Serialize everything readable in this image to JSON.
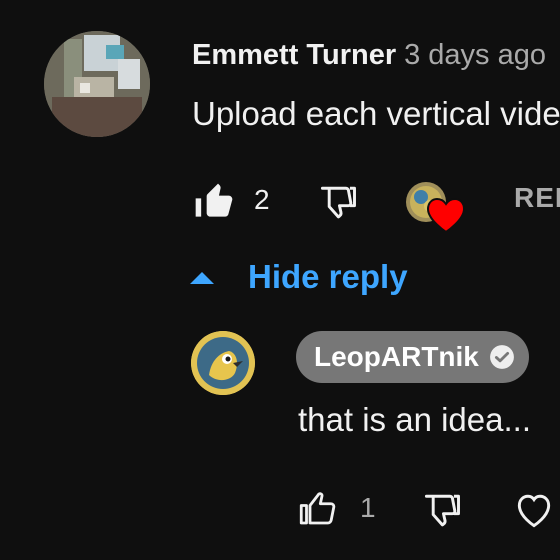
{
  "comment": {
    "author": "Emmett Turner",
    "timestamp": "3 days ago",
    "text": "Upload each vertical video",
    "like_count": "2",
    "reply_label": "REPLY",
    "icons": {
      "like": "thumbs-up-filled-icon",
      "dislike": "thumbs-down-outline-icon",
      "creator_heart": "creator-heart-icon"
    }
  },
  "replies_toggle": {
    "label": "Hide reply",
    "icon": "chevron-up-icon",
    "accent_color": "#3ea6ff"
  },
  "reply": {
    "author": "LeopARTnik",
    "verified": true,
    "text": "that is an idea...",
    "like_count": "1",
    "icons": {
      "like": "thumbs-up-outline-icon",
      "dislike": "thumbs-down-outline-icon",
      "heart": "heart-outline-icon",
      "verified": "verified-check-icon"
    }
  },
  "colors": {
    "background": "#0f0f0f",
    "text_primary": "#f1f1f1",
    "text_secondary": "#aaaaaa",
    "heart_red": "#ff0000",
    "author_pill": "#777777"
  }
}
